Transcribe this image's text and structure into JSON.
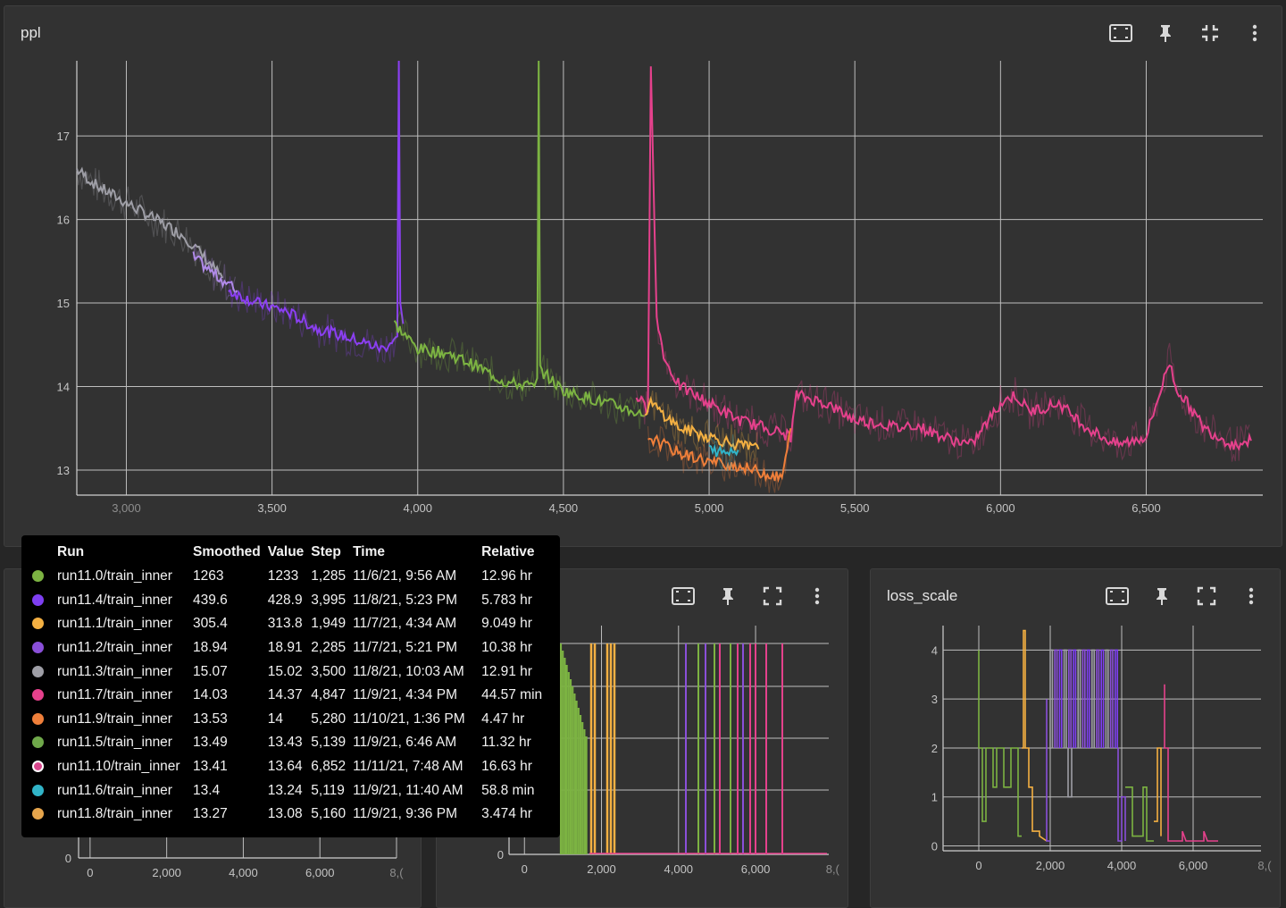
{
  "panels": {
    "main": {
      "title": "ppl"
    },
    "bottom_left": {
      "title": ""
    },
    "bottom_middle": {
      "title": ""
    },
    "bottom_right": {
      "title": "loss_scale"
    }
  },
  "icons": [
    "fit-domain-icon",
    "pin-icon",
    "collapse-icon",
    "more-vert-icon"
  ],
  "colors": {
    "run11.0": "#7cb342",
    "run11.4": "#7e3ff2",
    "run11.1": "#f4b042",
    "run11.2": "#8a4fd9",
    "run11.3": "#9e9ea6",
    "run11.7": "#e5418c",
    "run11.9": "#ef7f3a",
    "run11.5": "#6fa84a",
    "run11.10": "#d9478d",
    "run11.6": "#31b4c8",
    "run11.8": "#e6a54c"
  },
  "tooltip": {
    "headers": [
      "Run",
      "Smoothed",
      "Value",
      "Step",
      "Time",
      "Relative"
    ],
    "rows": [
      {
        "run": "run11.0/train_inner",
        "smoothed": "1263",
        "value": "1233",
        "step": "1,285",
        "time": "11/6/21, 9:56 AM",
        "relative": "12.96 hr",
        "color": "#7cb342",
        "ring": false
      },
      {
        "run": "run11.4/train_inner",
        "smoothed": "439.6",
        "value": "428.9",
        "step": "3,995",
        "time": "11/8/21, 5:23 PM",
        "relative": "5.783 hr",
        "color": "#7e3ff2",
        "ring": false
      },
      {
        "run": "run11.1/train_inner",
        "smoothed": "305.4",
        "value": "313.8",
        "step": "1,949",
        "time": "11/7/21, 4:34 AM",
        "relative": "9.049 hr",
        "color": "#f4b042",
        "ring": false
      },
      {
        "run": "run11.2/train_inner",
        "smoothed": "18.94",
        "value": "18.91",
        "step": "2,285",
        "time": "11/7/21, 5:21 PM",
        "relative": "10.38 hr",
        "color": "#8a4fd9",
        "ring": false
      },
      {
        "run": "run11.3/train_inner",
        "smoothed": "15.07",
        "value": "15.02",
        "step": "3,500",
        "time": "11/8/21, 10:03 AM",
        "relative": "12.91 hr",
        "color": "#9e9ea6",
        "ring": false
      },
      {
        "run": "run11.7/train_inner",
        "smoothed": "14.03",
        "value": "14.37",
        "step": "4,847",
        "time": "11/9/21, 4:34 PM",
        "relative": "44.57 min",
        "color": "#e5418c",
        "ring": false
      },
      {
        "run": "run11.9/train_inner",
        "smoothed": "13.53",
        "value": "14",
        "step": "5,280",
        "time": "11/10/21, 1:36 PM",
        "relative": "4.47 hr",
        "color": "#ef7f3a",
        "ring": false
      },
      {
        "run": "run11.5/train_inner",
        "smoothed": "13.49",
        "value": "13.43",
        "step": "5,139",
        "time": "11/9/21, 6:46 AM",
        "relative": "11.32 hr",
        "color": "#6fa84a",
        "ring": false
      },
      {
        "run": "run11.10/train_inner",
        "smoothed": "13.41",
        "value": "13.64",
        "step": "6,852",
        "time": "11/11/21, 7:48 AM",
        "relative": "16.63 hr",
        "color": "#d9478d",
        "ring": true
      },
      {
        "run": "run11.6/train_inner",
        "smoothed": "13.4",
        "value": "13.24",
        "step": "5,119",
        "time": "11/9/21, 11:40 AM",
        "relative": "58.8 min",
        "color": "#31b4c8",
        "ring": false
      },
      {
        "run": "run11.8/train_inner",
        "smoothed": "13.27",
        "value": "13.08",
        "step": "5,160",
        "time": "11/9/21, 9:36 PM",
        "relative": "3.474 hr",
        "color": "#e6a54c",
        "ring": false
      }
    ]
  },
  "chart_data": [
    {
      "type": "line",
      "title": "ppl",
      "xlabel": "",
      "ylabel": "",
      "xlim": [
        2830,
        6900
      ],
      "ylim": [
        12.7,
        17.9
      ],
      "x_ticks": [
        "3,000",
        "3,500",
        "4,000",
        "4,500",
        "5,000",
        "5,500",
        "6,000",
        "6,500"
      ],
      "x_tick_values": [
        3000,
        3500,
        4000,
        4500,
        5000,
        5500,
        6000,
        6500
      ],
      "y_ticks": [
        "13",
        "14",
        "15",
        "16",
        "17"
      ],
      "y_tick_values": [
        13,
        14,
        15,
        16,
        17
      ],
      "grid": true,
      "series": [
        {
          "name": "run11.3/train_inner",
          "color": "#9e9ea6",
          "x": [
            2830,
            2900,
            3000,
            3100,
            3200,
            3280,
            3330
          ],
          "y": [
            16.6,
            16.4,
            16.2,
            16.0,
            15.8,
            15.5,
            15.3
          ]
        },
        {
          "name": "run11.2/train_inner",
          "color": "#b08ae8",
          "x": [
            3230,
            3300,
            3380
          ],
          "y": [
            15.55,
            15.35,
            15.15
          ]
        },
        {
          "name": "run11.4/train_inner",
          "color": "#8b3ff2",
          "x": [
            3350,
            3450,
            3550,
            3650,
            3750,
            3880,
            3930,
            3935,
            3940,
            3950
          ],
          "y": [
            15.15,
            15.0,
            14.9,
            14.7,
            14.6,
            14.45,
            14.6,
            17.9,
            15.0,
            14.75
          ]
        },
        {
          "name": "run11.5/train_inner",
          "color": "#7cb342",
          "x": [
            3920,
            4000,
            4100,
            4200,
            4300,
            4400,
            4410,
            4415,
            4420,
            4500,
            4600,
            4700,
            4780
          ],
          "y": [
            14.75,
            14.45,
            14.4,
            14.25,
            14.05,
            14.0,
            14.1,
            17.9,
            14.2,
            13.95,
            13.85,
            13.75,
            13.65
          ]
        },
        {
          "name": "run11.7/train_inner",
          "color": "#e5418c",
          "x": [
            4750,
            4790,
            4800,
            4820,
            4850,
            4900,
            5000,
            5100,
            5200,
            5280,
            5300,
            5400,
            5500,
            5600,
            5650,
            5700,
            5800,
            5900,
            6000,
            6050,
            6100,
            6200,
            6300,
            6400,
            6500,
            6580,
            6600,
            6700,
            6800,
            6860
          ],
          "y": [
            13.9,
            13.7,
            17.9,
            14.8,
            14.3,
            14.0,
            13.8,
            13.6,
            13.5,
            13.4,
            13.9,
            13.8,
            13.6,
            13.55,
            13.5,
            13.55,
            13.4,
            13.3,
            13.8,
            13.9,
            13.7,
            13.8,
            13.5,
            13.3,
            13.4,
            14.3,
            14.0,
            13.5,
            13.3,
            13.35
          ]
        },
        {
          "name": "run11.1/train_inner",
          "color": "#f4b042",
          "x": [
            4780,
            4800,
            4900,
            5000,
            5100,
            5170
          ],
          "y": [
            13.7,
            13.8,
            13.5,
            13.4,
            13.3,
            13.25
          ]
        },
        {
          "name": "run11.9/train_inner",
          "color": "#ef7f3a",
          "x": [
            4790,
            4900,
            5000,
            5100,
            5200,
            5250,
            5280
          ],
          "y": [
            13.4,
            13.2,
            13.1,
            13.05,
            12.95,
            12.9,
            13.5
          ]
        },
        {
          "name": "run11.6/train_inner",
          "color": "#31b4c8",
          "x": [
            5000,
            5050,
            5100
          ],
          "y": [
            13.25,
            13.2,
            13.24
          ]
        }
      ]
    },
    {
      "type": "line",
      "title": "",
      "xlim": [
        -300,
        8000
      ],
      "x_ticks": [
        "0",
        "2,000",
        "4,000",
        "6,000",
        "8,("
      ],
      "x_tick_values": [
        0,
        2000,
        4000,
        6000,
        8000
      ],
      "y_ticks": [
        "0"
      ],
      "y_tick_values": [
        0
      ],
      "grid": true
    },
    {
      "type": "line",
      "title": "",
      "xlim": [
        -400,
        7900
      ],
      "x_ticks": [
        "0",
        "2,000",
        "4,000",
        "6,000",
        "8,("
      ],
      "x_tick_values": [
        0,
        2000,
        4000,
        6000,
        8000
      ],
      "y_ticks": [
        "0"
      ],
      "y_tick_values": [
        0
      ],
      "grid": true
    },
    {
      "type": "line",
      "title": "loss_scale",
      "xlim": [
        -1000,
        7900
      ],
      "ylim": [
        -0.1,
        4.5
      ],
      "x_ticks": [
        "0",
        "2,000",
        "4,000",
        "6,000",
        "8,("
      ],
      "x_tick_values": [
        0,
        2000,
        4000,
        6000,
        8000
      ],
      "y_ticks": [
        "0",
        "1",
        "2",
        "3",
        "4"
      ],
      "y_tick_values": [
        0,
        1,
        2,
        3,
        4
      ],
      "grid": true
    }
  ]
}
